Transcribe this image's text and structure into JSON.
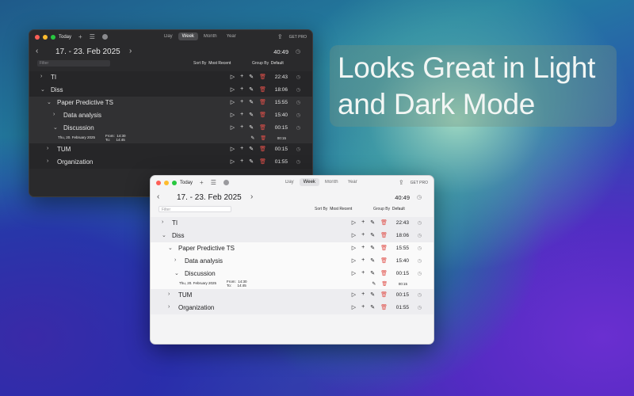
{
  "headline": {
    "line1": "Looks Great in Light",
    "line2": "and Dark Mode"
  },
  "windows": {
    "dark": {
      "toolbar": {
        "today": "Today",
        "add": "+",
        "list": "☰"
      },
      "tabs": {
        "day": "Day",
        "week": "Week",
        "month": "Month",
        "year": "Year",
        "active": "Week"
      },
      "get_pro": "GET PRO",
      "prev": "‹",
      "next": "›",
      "date_range": "17. - 23. Feb 2025",
      "total": "40:49",
      "filter_placeholder": "Filter",
      "sort_by_label": "Sort By",
      "sort_by_value": "Most Recent",
      "group_by_label": "Group By",
      "group_by_value": "Default",
      "rows": [
        {
          "label": "TI",
          "time": "22:43",
          "expanded": false
        },
        {
          "label": "Diss",
          "time": "18:06",
          "expanded": true
        },
        {
          "label": "Paper Predictive TS",
          "time": "15:55",
          "expanded": true
        },
        {
          "label": "Data analysis",
          "time": "15:40",
          "expanded": false
        },
        {
          "label": "Discussion",
          "time": "00:15",
          "expanded": true
        },
        {
          "label": "TUM",
          "time": "00:15",
          "expanded": false
        },
        {
          "label": "Organization",
          "time": "01:55",
          "expanded": false
        }
      ],
      "entry": {
        "date": "Thu, 20. February 2025",
        "from_label": "From:",
        "from": "14:30",
        "to_label": "To:",
        "to": "14:45",
        "time": "00:15"
      }
    },
    "light": {
      "toolbar": {
        "today": "Today",
        "add": "+",
        "list": "☰"
      },
      "tabs": {
        "day": "Day",
        "week": "Week",
        "month": "Month",
        "year": "Year",
        "active": "Week"
      },
      "get_pro": "GET PRO",
      "prev": "‹",
      "next": "›",
      "date_range": "17. - 23. Feb 2025",
      "total": "40:49",
      "filter_placeholder": "Filter",
      "sort_by_label": "Sort By",
      "sort_by_value": "Most Recent",
      "group_by_label": "Group By",
      "group_by_value": "Default",
      "rows": [
        {
          "label": "TI",
          "time": "22:43",
          "expanded": false
        },
        {
          "label": "Diss",
          "time": "18:06",
          "expanded": true
        },
        {
          "label": "Paper Predictive TS",
          "time": "15:55",
          "expanded": true
        },
        {
          "label": "Data analysis",
          "time": "15:40",
          "expanded": false
        },
        {
          "label": "Discussion",
          "time": "00:15",
          "expanded": true
        },
        {
          "label": "TUM",
          "time": "00:15",
          "expanded": false
        },
        {
          "label": "Organization",
          "time": "01:55",
          "expanded": false
        }
      ],
      "entry": {
        "date": "Thu, 20. February 2025",
        "from_label": "From:",
        "from": "14:30",
        "to_label": "To:",
        "to": "14:45",
        "time": "00:15"
      }
    }
  },
  "icons": {
    "play": "▷",
    "add": "+",
    "edit": "✎",
    "delete": "🗑",
    "expand": "›",
    "collapse": "⌄",
    "history": "◷",
    "share": "⇪"
  },
  "colors": {
    "delete": "#e0504a",
    "dark_window": "#2a2a2c",
    "light_window": "#f4f4f5"
  }
}
